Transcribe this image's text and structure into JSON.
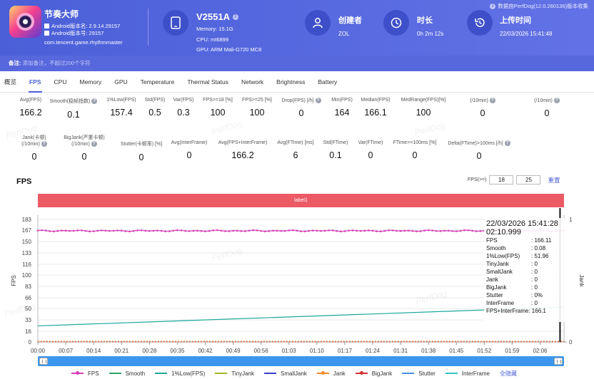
{
  "header": {
    "app_name": "节奏大师",
    "android_version_name": "Android版本名: 2.9.14.29157",
    "android_version_code": "Android版本号: 29157",
    "package": "com.tencent.game.rhythmmaster",
    "device_name": "V2551A",
    "memory": "Memory: 15.1G",
    "cpu": "CPU: mt6899",
    "gpu": "GPU: ARM Mali-G720 MC8",
    "creator_label": "创建者",
    "creator_value": "ZOL",
    "duration_label": "时长",
    "duration_value": "0h 2m 12s",
    "upload_label": "上传时间",
    "upload_value": "22/03/2026 15:41:48",
    "version_note": "数据由PerfDog(12.0.260136)版本收集",
    "remark_label": "备注:",
    "remark_placeholder": "添加备注，不超过200个字符"
  },
  "tabs": [
    "概览",
    "FPS",
    "CPU",
    "Memory",
    "GPU",
    "Temperature",
    "Thermal Status",
    "Network",
    "Brightness",
    "Battery"
  ],
  "stats_row1": [
    {
      "label": "Avg(FPS)",
      "value": "166.2"
    },
    {
      "label": "Smooth(稳帧指数)",
      "value": "0.1"
    },
    {
      "label": "1%Low(FPS)",
      "value": "157.4"
    },
    {
      "label": "Std(FPS)",
      "value": "0.5"
    },
    {
      "label": "Var(FPS)",
      "value": "0.3"
    },
    {
      "label": "FPS>=18 [%]",
      "value": "100"
    },
    {
      "label": "FPS>=25 [%]",
      "value": "100"
    },
    {
      "label": "Drop(FPS) [/h]",
      "value": "0"
    },
    {
      "label": "Min(FPS)",
      "value": "164"
    },
    {
      "label": "Median(FPS)",
      "value": "166.1"
    },
    {
      "label": "MedRange(FPS)[%]",
      "value": "100"
    },
    {
      "label": "(/10min)",
      "value": "0"
    },
    {
      "label": "(/10min)",
      "value": "0"
    }
  ],
  "stats_row2": [
    {
      "label": "Jank(卡顿)",
      "sub": "(/10min)",
      "value": "0"
    },
    {
      "label": "BigJank(严重卡顿)",
      "sub": "(/10min)",
      "value": "0"
    },
    {
      "label": "Stutter(卡顿率) [%]",
      "sub": "",
      "value": "0"
    },
    {
      "label": "Avg(InterFrame)",
      "sub": "",
      "value": "0"
    },
    {
      "label": "Avg(FPS+InterFrame)",
      "sub": "",
      "value": "166.2"
    },
    {
      "label": "Avg(FTime) [ms]",
      "sub": "",
      "value": "6"
    },
    {
      "label": "Std(FTime)",
      "sub": "",
      "value": "0.1"
    },
    {
      "label": "Var(FTime)",
      "sub": "",
      "value": "0"
    },
    {
      "label": "FTime>=100ms [%]",
      "sub": "",
      "value": "0"
    },
    {
      "label": "Delta(FTime)>100ms [/h]",
      "sub": "",
      "value": "0"
    }
  ],
  "watermark": "PerfDog",
  "chart_section": {
    "title": "FPS",
    "threshold_label": "FPS(>=)",
    "threshold_1": "18",
    "threshold_2": "25",
    "reset_label": "重置",
    "label_bar": "label1"
  },
  "tooltip": {
    "time": "22/03/2026 15:41:28",
    "time_ms": "02:10.999",
    "rows": [
      {
        "k": "FPS",
        "v": ": 166.11"
      },
      {
        "k": "Smooth",
        "v": ": 0.08"
      },
      {
        "k": "1%Low(FPS)",
        "v": ": 51.96"
      },
      {
        "k": "TinyJank",
        "v": ": 0"
      },
      {
        "k": "SmallJank",
        "v": ": 0"
      },
      {
        "k": "Jank",
        "v": ": 0"
      },
      {
        "k": "BigJank",
        "v": ": 0"
      },
      {
        "k": "Stutter",
        "v": ": 0%"
      },
      {
        "k": "InterFrame",
        "v": ": 0"
      }
    ],
    "fps_interframe": "FPS+InterFrame: 166.1"
  },
  "legend": {
    "items": [
      {
        "name": "FPS",
        "color": "#d63fb8",
        "dot": true
      },
      {
        "name": "Smooth",
        "color": "#2fa36b",
        "dot": false
      },
      {
        "name": "1%Low(FPS)",
        "color": "#1aa89a",
        "dot": false
      },
      {
        "name": "TinyJank",
        "color": "#a3b61f",
        "dot": false
      },
      {
        "name": "SmallJank",
        "color": "#3b3fc9",
        "dot": false
      },
      {
        "name": "Jank",
        "color": "#f08a2a",
        "dot": true
      },
      {
        "name": "BigJank",
        "color": "#d62f2f",
        "dot": true
      },
      {
        "name": "Stutter",
        "color": "#4a90e2",
        "dot": false
      },
      {
        "name": "InterFrame",
        "color": "#36c1c1",
        "dot": false
      }
    ],
    "show_all": "全隐藏"
  },
  "chart_data": {
    "type": "line",
    "ylabel": "FPS",
    "y2label": "Jank",
    "y_ticks": [
      0,
      16,
      33,
      50,
      66,
      83,
      100,
      116,
      133,
      150,
      167,
      183
    ],
    "ylim": [
      0,
      183
    ],
    "y2_ticks": [
      0,
      1
    ],
    "x_ticks": [
      "00:00",
      "00:07",
      "00:14",
      "00:21",
      "00:28",
      "00:35",
      "00:42",
      "00:49",
      "00:56",
      "01:03",
      "01:10",
      "01:17",
      "01:24",
      "01:31",
      "01:38",
      "01:45",
      "01:52",
      "01:59",
      "02:06"
    ],
    "x_range_seconds": [
      0,
      132
    ],
    "cursor_seconds": 131,
    "series": [
      {
        "name": "FPS",
        "color": "#d63fb8",
        "approx_value": 166,
        "min": 164,
        "max": 168
      },
      {
        "name": "1%Low(FPS)",
        "color": "#1aa89a",
        "start": 24,
        "end": 52
      },
      {
        "name": "Jank",
        "color": "#f08a2a",
        "value": 0
      },
      {
        "name": "BigJank",
        "color": "#d62f2f",
        "value": 0
      }
    ]
  }
}
